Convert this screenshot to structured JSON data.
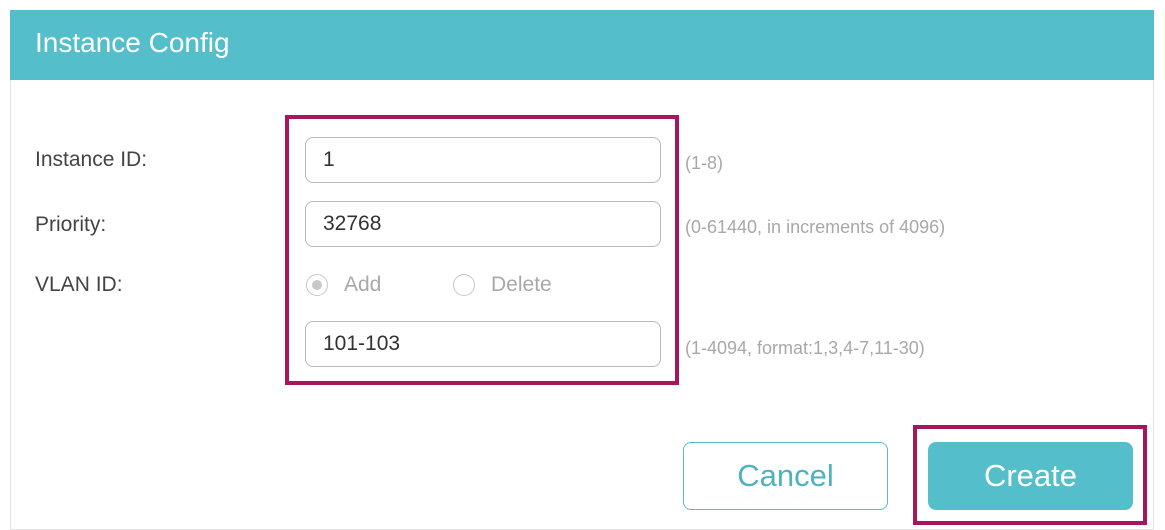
{
  "header": {
    "title": "Instance Config"
  },
  "form": {
    "instance_id": {
      "label": "Instance ID:",
      "value": "1",
      "hint": "(1-8)"
    },
    "priority": {
      "label": "Priority:",
      "value": "32768",
      "hint": "(0-61440, in increments of 4096)"
    },
    "vlan_id": {
      "label": "VLAN ID:",
      "options": [
        {
          "label": "Add",
          "selected": true
        },
        {
          "label": "Delete",
          "selected": false
        }
      ],
      "value": "101-103",
      "hint": "(1-4094, format:1,3,4-7,11-30)"
    }
  },
  "buttons": {
    "cancel": "Cancel",
    "create": "Create"
  },
  "colors": {
    "accent": "#54bfcb",
    "highlight": "#a5165c"
  }
}
